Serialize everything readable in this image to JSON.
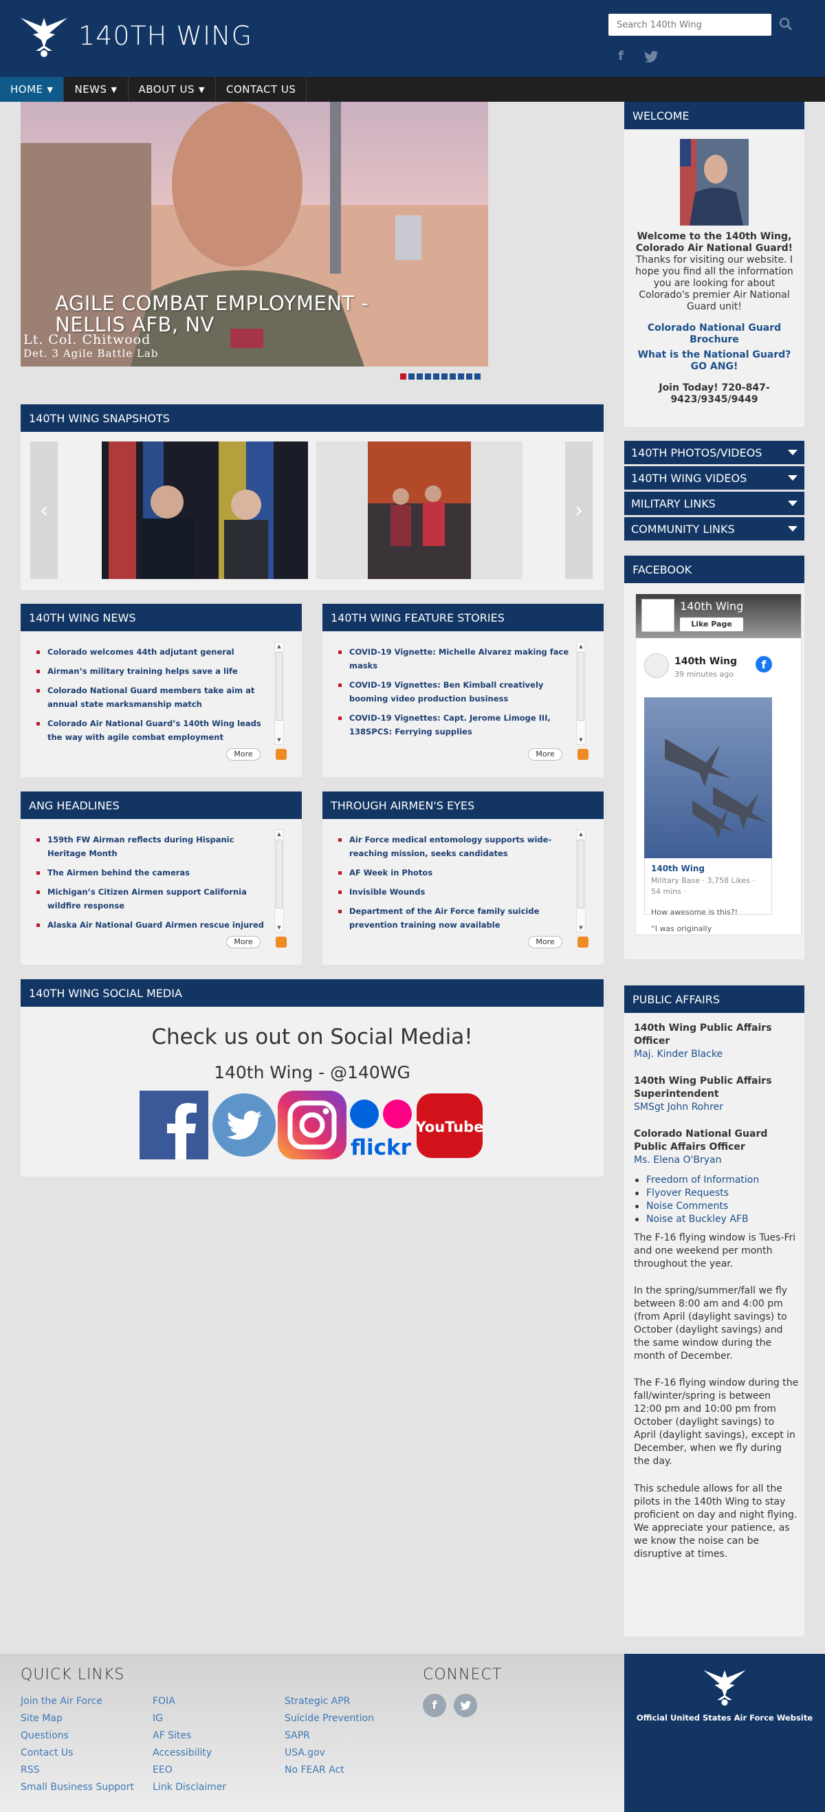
{
  "header": {
    "site_title": "140TH WING",
    "search_placeholder": "Search 140th Wing",
    "social_icons": [
      "facebook-icon",
      "twitter-icon"
    ]
  },
  "nav": {
    "items": [
      {
        "label": "HOME",
        "dropdown": true,
        "active": true
      },
      {
        "label": "NEWS",
        "dropdown": true
      },
      {
        "label": "ABOUT US",
        "dropdown": true
      },
      {
        "label": "CONTACT US",
        "dropdown": false
      }
    ]
  },
  "hero": {
    "caption_line1": "AGILE COMBAT EMPLOYMENT -",
    "caption_line2": "NELLIS AFB, NV",
    "name_line": "Lt. Col. Chitwood",
    "unit_line": "Det. 3 Agile Battle Lab",
    "slide_count": 10,
    "active_slide": 1
  },
  "snapshots": {
    "title": "140TH WING SNAPSHOTS",
    "prev": "‹",
    "next": "›"
  },
  "panels": {
    "news": {
      "title": "140TH WING NEWS",
      "items": [
        "Colorado welcomes 44th adjutant general",
        "Airman’s military training helps save a life",
        "Colorado National Guard members take aim at annual state marksmanship match",
        "Colorado Air National Guard’s 140th Wing leads the way with agile combat employment"
      ],
      "more": "More"
    },
    "feature": {
      "title": "140TH WING FEATURE STORIES",
      "items": [
        "COVID-19 Vignette: Michelle Alvarez making face masks",
        "COVID-19 Vignettes: Ben Kimball creatively booming video production business",
        "COVID-19 Vignettes: Capt. Jerome Limoge III, 138SPCS: Ferrying supplies"
      ],
      "more": "More"
    },
    "ang": {
      "title": "ANG HEADLINES",
      "items": [
        "159th FW Airman reflects during Hispanic Heritage Month",
        "The Airmen behind the cameras",
        "Michigan’s Citizen Airmen support California wildfire response",
        "Alaska Air National Guard Airmen rescue injured"
      ],
      "more": "More"
    },
    "eyes": {
      "title": "THROUGH AIRMEN'S EYES",
      "items": [
        "Air Force medical entomology supports wide-reaching mission, seeks candidates",
        "AF Week in Photos",
        "Invisible Wounds",
        "Department of the Air Force family suicide prevention training now available"
      ],
      "more": "More"
    }
  },
  "social": {
    "title": "140TH WING SOCIAL MEDIA",
    "heading": "Check us out on Social Media!",
    "handle": "140th Wing - @140WG",
    "flickr_text": "flickr",
    "youtube_text": "YouTube"
  },
  "sidebar": {
    "welcome": {
      "title": "WELCOME",
      "bold": "Welcome to the 140th Wing, Colorado Air National Guard!",
      "body": "Thanks for visiting our website. I hope you find all the information you are looking for about Colorado's premier Air National Guard unit!",
      "link1": "Colorado National Guard Brochure",
      "link2": "What is the National Guard? GO ANG!",
      "join": "Join Today! 720-847-9423/9345/9449"
    },
    "accordions": [
      "140TH PHOTOS/VIDEOS",
      "140TH WING VIDEOS",
      "MILITARY LINKS",
      "COMMUNITY LINKS"
    ],
    "facebook": {
      "title": "FACEBOOK",
      "page_name": "140th Wing",
      "like_label": "Like Page",
      "post_name": "140th Wing",
      "post_time": "39 minutes ago",
      "card_name": "140th Wing",
      "card_meta1": "Military Base · 3,758 Likes ·",
      "card_meta2": "54 mins ·",
      "post_text": "How awesome is this?!",
      "quote": "“I was originally"
    },
    "public_affairs": {
      "title": "PUBLIC AFFAIRS",
      "officer_title": "140th Wing Public Affairs Officer",
      "officer_name": "Maj. Kinder Blacke",
      "super_title": "140th Wing Public Affairs Superintendent",
      "super_name": "SMSgt John Rohrer",
      "cong_title": "Colorado National Guard Public Affairs Officer",
      "cong_name": "Ms. Elena O'Bryan",
      "links": [
        "Freedom of Information",
        "Flyover Requests",
        "Noise Comments",
        "Noise at Buckley AFB"
      ],
      "p1": "The F-16 flying window is Tues-Fri and one weekend per month throughout the year.",
      "p2": "In the spring/summer/fall we fly between 8:00 am and 4:00 pm (from April (daylight savings) to October (daylight savings) and the same window during the month of December.",
      "p3": "The F-16 flying window during the fall/winter/spring is between 12:00 pm and 10:00 pm from October (daylight savings) to April (daylight savings), except in December, when we fly during the day.",
      "p4": "This schedule allows for all the pilots in the 140th Wing to stay proficient on day and night flying. We appreciate your patience, as we know the noise can be disruptive at times."
    }
  },
  "footer": {
    "quick_links_title": "QUICK LINKS",
    "connect_title": "CONNECT",
    "col1": [
      "Join the Air Force",
      "Site Map",
      "Questions",
      "Contact Us",
      "RSS",
      "Small Business Support"
    ],
    "col2": [
      "FOIA",
      "IG",
      "AF Sites",
      "Accessibility",
      "EEO",
      "Link Disclaimer"
    ],
    "col3": [
      "Strategic APR",
      "Suicide Prevention",
      "SAPR",
      "USA.gov",
      "No FEAR Act"
    ],
    "af_caption": "Official United States Air Force Website"
  },
  "colors": {
    "navy": "#123563",
    "nav_bg": "#202020",
    "link": "#1c4f8b",
    "bullet_red": "#c0182b",
    "rss_orange": "#f08a24"
  }
}
